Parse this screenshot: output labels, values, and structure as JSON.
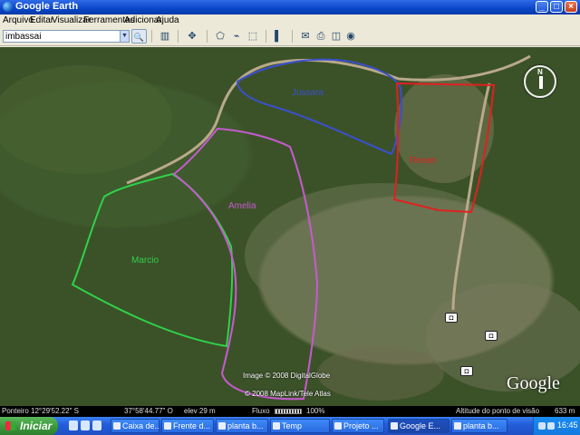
{
  "window": {
    "title": "Google Earth",
    "minimize": "_",
    "maximize": "□",
    "close": "×"
  },
  "menu": [
    "Arquivo",
    "Editar",
    "Visualizar",
    "Ferramentas",
    "Adicionar",
    "Ajuda"
  ],
  "search": {
    "value": "imbassai",
    "dropdown_glyph": "▼",
    "button_glyph": "🔍"
  },
  "toolbar": [
    {
      "icon": "sidebar-icon",
      "glyph": "▥"
    },
    {
      "icon": "placemark-icon",
      "glyph": "✥"
    },
    {
      "icon": "polygon-icon",
      "glyph": "⬠"
    },
    {
      "icon": "path-icon",
      "glyph": "⌁"
    },
    {
      "icon": "overlay-icon",
      "glyph": "⬚"
    },
    {
      "icon": "ruler-icon",
      "glyph": "▌"
    },
    {
      "icon": "email-icon",
      "glyph": "✉"
    },
    {
      "icon": "print-icon",
      "glyph": "⎙"
    },
    {
      "icon": "map-icon",
      "glyph": "◫"
    },
    {
      "icon": "web-icon",
      "glyph": "◉"
    }
  ],
  "map": {
    "labels": {
      "blue": "Jussara",
      "red": "Renan",
      "green": "Marcio",
      "purple": "Amelia"
    },
    "colors": {
      "blue": "#3b4fd0",
      "red": "#e02020",
      "green": "#2fd14a",
      "purple": "#c65ad0",
      "road": "#b9a98a"
    },
    "compass_letter": "N",
    "copyright_1": "Image © 2008 DigitalGlobe",
    "copyright_2": "© 2008 MapLink/Tele Atlas",
    "logo": "Google",
    "camera_glyph": "◘"
  },
  "status": {
    "pointer": "Ponteiro  12°29'52.22\" S",
    "longitude": "37°58'44.77\" O",
    "elevation": "elev   29 m",
    "streaming_label": "Fluxo",
    "streaming_pct": "100%",
    "eye_alt": "Altitude do ponto de visão",
    "eye_alt_value": "633 m"
  },
  "taskbar": {
    "start": "Iniciar",
    "tasks": [
      {
        "label": "Caixa de...",
        "active": false
      },
      {
        "label": "Frente d...",
        "active": false
      },
      {
        "label": "planta b...",
        "active": false
      },
      {
        "label": "Temp",
        "active": false
      },
      {
        "label": "Projeto ...",
        "active": false
      },
      {
        "label": "Google E...",
        "active": true
      },
      {
        "label": "planta b...",
        "active": false
      }
    ],
    "clock": "16:45"
  }
}
